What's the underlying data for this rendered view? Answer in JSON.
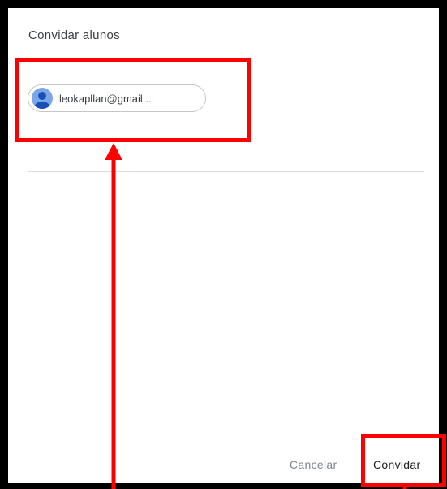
{
  "dialog": {
    "title": "Convidar alunos",
    "chips": [
      {
        "email": "leokapllan@gmail...."
      }
    ],
    "cancel_label": "Cancelar",
    "invite_label": "Convidar"
  },
  "annotations": {
    "highlight_color": "#ff0000"
  },
  "icons": {
    "avatar": "person-avatar-icon"
  }
}
